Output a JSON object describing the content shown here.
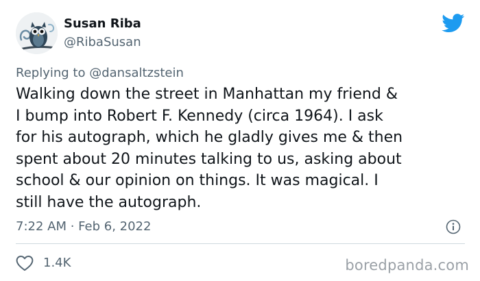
{
  "author": {
    "display_name": "Susan Riba",
    "handle": "@RibaSusan",
    "avatar_icon": "owl-avatar"
  },
  "platform_icon": "twitter-bird-icon",
  "reply": {
    "prefix": "Replying to",
    "mention": "@dansaltzstein"
  },
  "tweet": {
    "text": "Walking down the street in Manhattan my friend &\nI bump into Robert F. Kennedy (circa 1964). I ask\nfor his autograph, which he gladly gives me & then\nspent about 20 minutes talking to us, asking about\nschool & our opinion on things. It was magical. I\nstill have the autograph.",
    "timestamp": "7:22 AM · Feb 6, 2022"
  },
  "actions": {
    "like_count": "1.4K",
    "like_icon": "heart-icon",
    "info_icon": "info-icon"
  },
  "watermark": "boredpanda.com",
  "colors": {
    "text": "#0f1419",
    "secondary": "#536471",
    "twitter_blue": "#1d9bf0",
    "divider": "#cfd9de",
    "watermark": "#9aa0a6"
  }
}
